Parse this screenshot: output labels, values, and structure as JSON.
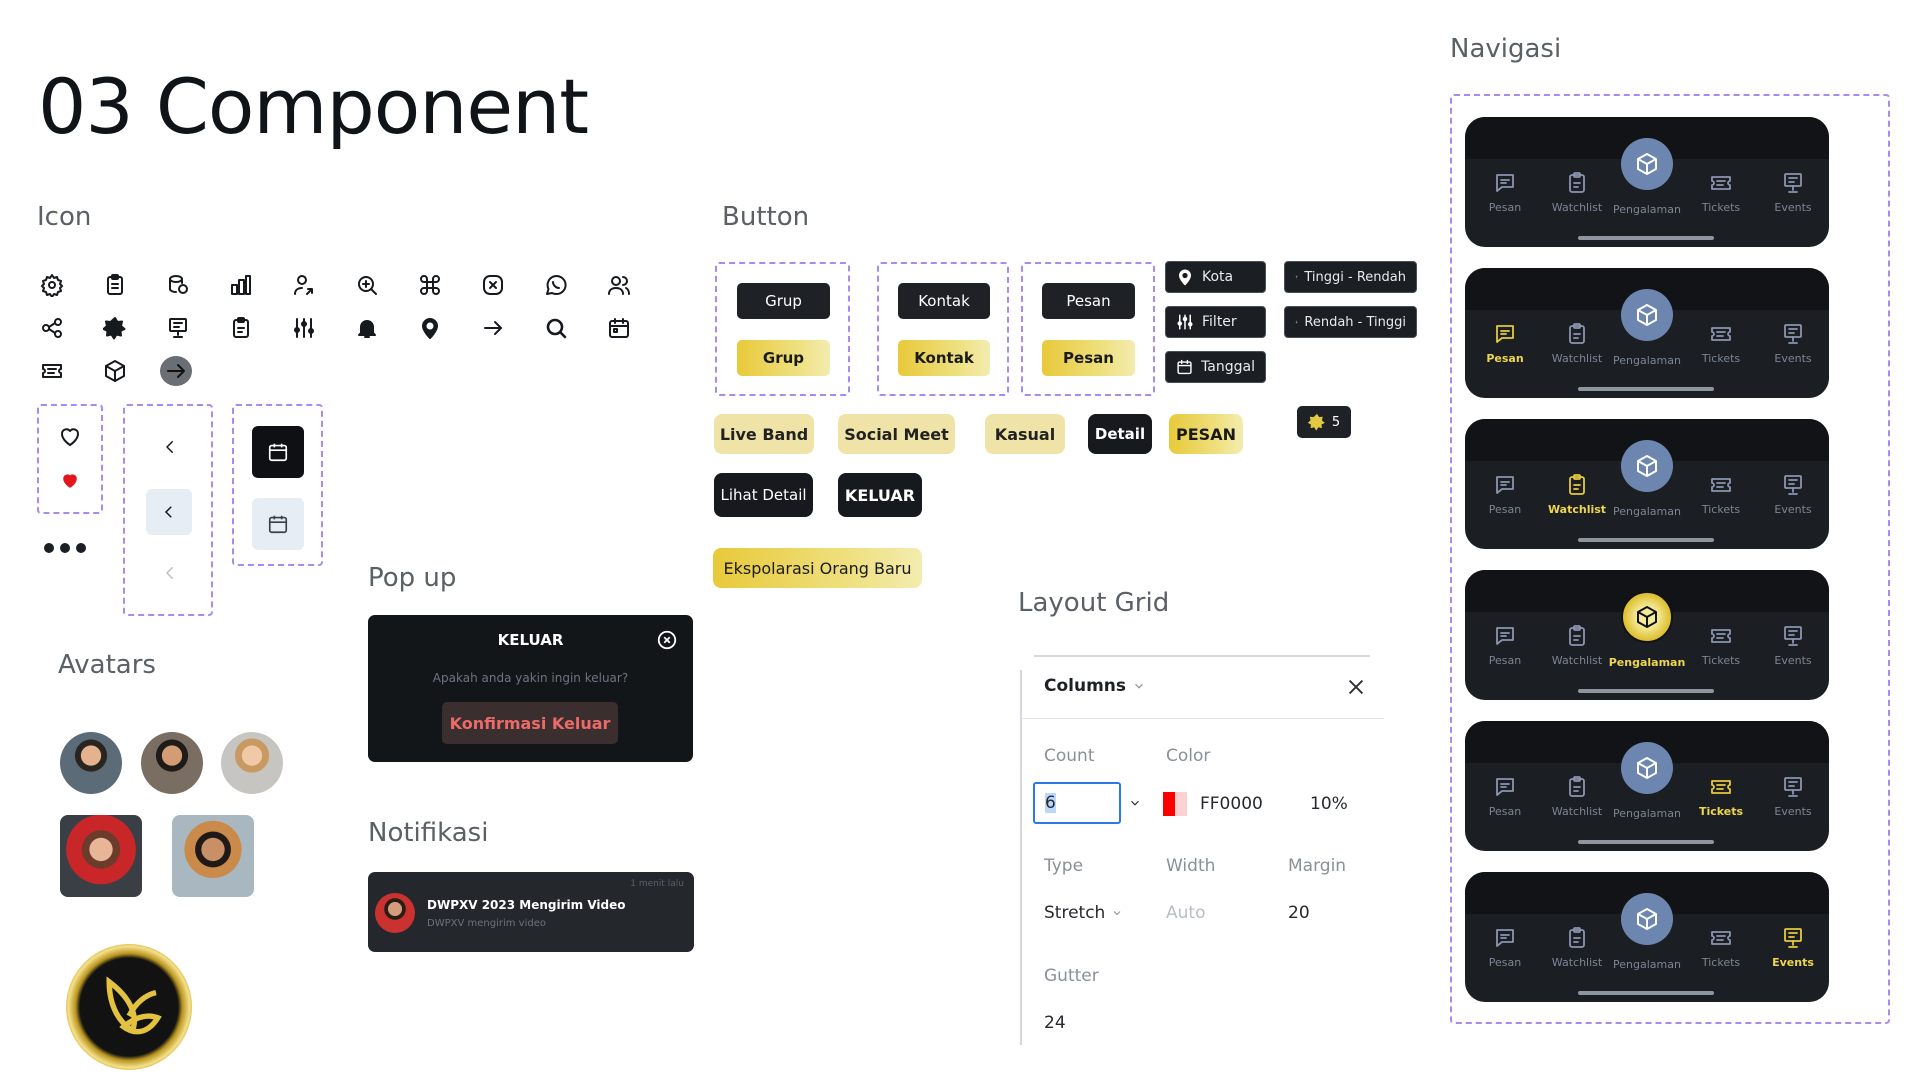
{
  "title": "03 Component",
  "sections": {
    "icon": "Icon",
    "button": "Button",
    "navigasi": "Navigasi",
    "avatars": "Avatars",
    "popup": "Pop up",
    "notifikasi": "Notifikasi",
    "layout_grid": "Layout Grid"
  },
  "icons_row1": [
    "gear-icon",
    "clipboard-icon",
    "database-icon",
    "bar-chart-icon",
    "user-arrow-icon",
    "zoom-icon",
    "command-icon",
    "close-square-icon",
    "whatsapp-icon",
    "users-icon"
  ],
  "icons_row2": [
    "share-icon",
    "star-badge-icon",
    "presentation-icon",
    "clipboard-check-icon",
    "sliders-icon",
    "bell-icon",
    "map-pin-icon",
    "arrow-right-icon",
    "search-icon",
    "calendar-icon"
  ],
  "icons_row3": [
    "ticket-icon",
    "cube-icon",
    "arrow-circle-icon"
  ],
  "buttons": {
    "grup": "Grup",
    "kontak": "Kontak",
    "pesan": "Pesan",
    "kota": "Kota",
    "filter": "Filter",
    "tanggal": "Tanggal",
    "tinggi_rendah": "Tinggi - Rendah",
    "rendah_tinggi": "Rendah - Tinggi",
    "rating": "5",
    "live_band": "Live Band",
    "social_meet": "Social Meet",
    "kasual": "Kasual",
    "detail": "Detail",
    "pesan_caps": "PESAN",
    "lihat_detail": "Lihat Detail",
    "keluar": "KELUAR",
    "eksplorasi": "Ekspolarasi Orang Baru"
  },
  "popup": {
    "title": "KELUAR",
    "message": "Apakah anda yakin ingin keluar?",
    "confirm": "Konfirmasi Keluar"
  },
  "notification": {
    "time": "1 menit lalu",
    "title": "DWPXV 2023 Mengirim Video",
    "subtitle": "DWPXV mengirim video"
  },
  "layout_grid": {
    "panel_title": "Columns",
    "count_label": "Count",
    "count_value": "6",
    "color_label": "Color",
    "color_value": "FF0000",
    "color_hex": "#ff0000",
    "opacity": "10%",
    "type_label": "Type",
    "type_value": "Stretch",
    "width_label": "Width",
    "width_value": "Auto",
    "margin_label": "Margin",
    "margin_value": "20",
    "gutter_label": "Gutter",
    "gutter_value": "24"
  },
  "nav": {
    "items": [
      "Pesan",
      "Watchlist",
      "Pengalaman",
      "Tickets",
      "Events"
    ],
    "active_indices": [
      -1,
      0,
      1,
      2,
      3,
      4
    ]
  },
  "colors": {
    "gold": "#e8c93a",
    "dark": "#1e2227",
    "accent_dash": "#a98bf0",
    "heart": "#e2161b"
  }
}
